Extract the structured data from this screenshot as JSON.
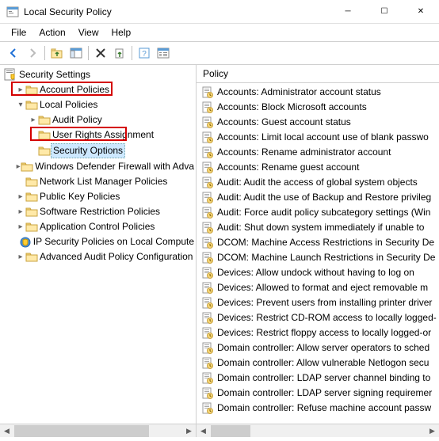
{
  "window": {
    "title": "Local Security Policy"
  },
  "menu": {
    "file": "File",
    "action": "Action",
    "view": "View",
    "help": "Help"
  },
  "tree": {
    "root": "Security Settings",
    "items": [
      {
        "label": "Account Policies",
        "indent": 1,
        "caret": "▸",
        "icon": "folder"
      },
      {
        "label": "Local Policies",
        "indent": 1,
        "caret": "▾",
        "icon": "folder",
        "highlight": true
      },
      {
        "label": "Audit Policy",
        "indent": 2,
        "caret": "▸",
        "icon": "folder"
      },
      {
        "label": "User Rights Assignment",
        "indent": 2,
        "caret": "",
        "icon": "folder"
      },
      {
        "label": "Security Options",
        "indent": 2,
        "caret": "",
        "icon": "folder",
        "highlight": true,
        "selected": true
      },
      {
        "label": "Windows Defender Firewall with Adva",
        "indent": 1,
        "caret": "▸",
        "icon": "folder"
      },
      {
        "label": "Network List Manager Policies",
        "indent": 1,
        "caret": "",
        "icon": "folder"
      },
      {
        "label": "Public Key Policies",
        "indent": 1,
        "caret": "▸",
        "icon": "folder"
      },
      {
        "label": "Software Restriction Policies",
        "indent": 1,
        "caret": "▸",
        "icon": "folder"
      },
      {
        "label": "Application Control Policies",
        "indent": 1,
        "caret": "▸",
        "icon": "folder"
      },
      {
        "label": "IP Security Policies on Local Compute",
        "indent": 1,
        "caret": "",
        "icon": "shield"
      },
      {
        "label": "Advanced Audit Policy Configuration",
        "indent": 1,
        "caret": "▸",
        "icon": "folder"
      }
    ]
  },
  "list": {
    "header": "Policy",
    "items": [
      "Accounts: Administrator account status",
      "Accounts: Block Microsoft accounts",
      "Accounts: Guest account status",
      "Accounts: Limit local account use of blank passwo",
      "Accounts: Rename administrator account",
      "Accounts: Rename guest account",
      "Audit: Audit the access of global system objects",
      "Audit: Audit the use of Backup and Restore privileg",
      "Audit: Force audit policy subcategory settings (Win",
      "Audit: Shut down system immediately if unable to",
      "DCOM: Machine Access Restrictions in Security De",
      "DCOM: Machine Launch Restrictions in Security De",
      "Devices: Allow undock without having to log on",
      "Devices: Allowed to format and eject removable m",
      "Devices: Prevent users from installing printer driver",
      "Devices: Restrict CD-ROM access to locally logged-",
      "Devices: Restrict floppy access to locally logged-or",
      "Domain controller: Allow server operators to sched",
      "Domain controller: Allow vulnerable Netlogon secu",
      "Domain controller: LDAP server channel binding to",
      "Domain controller: LDAP server signing requiremer",
      "Domain controller: Refuse machine account passw"
    ]
  }
}
